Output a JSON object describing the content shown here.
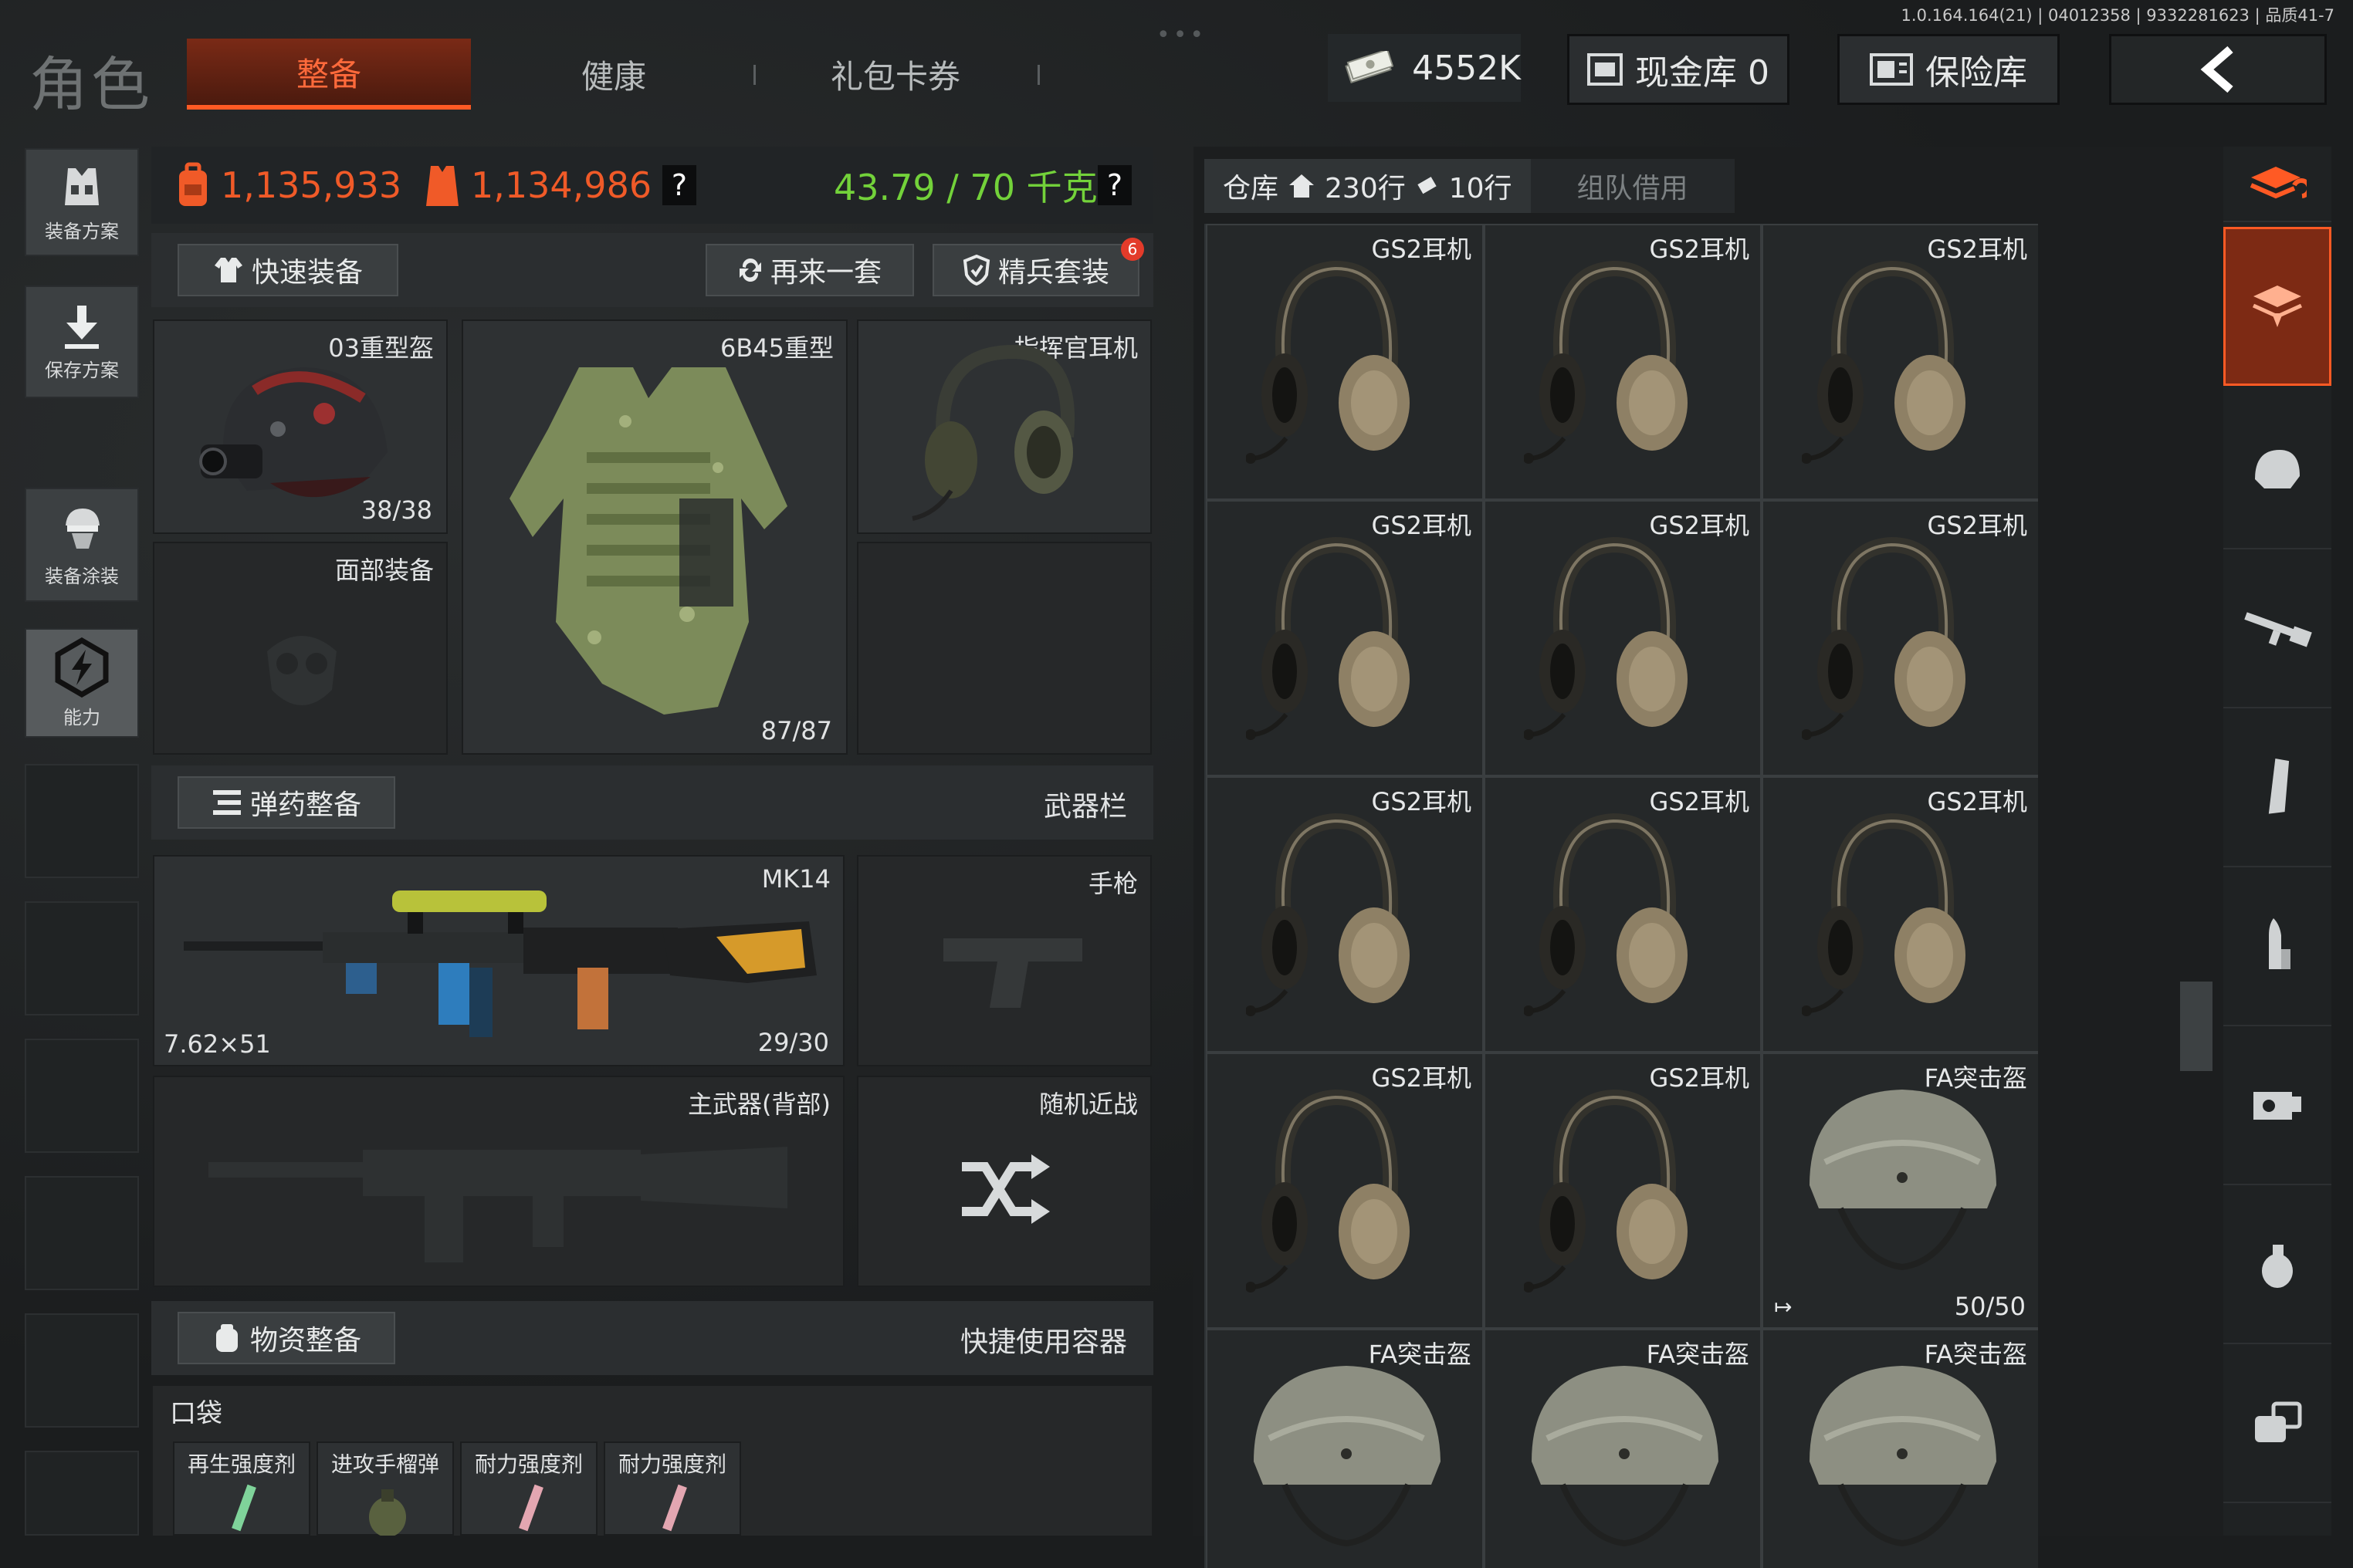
{
  "build_info": "1.0.164.164(21) | 04012358 | 9332281623 | 品质41-7",
  "header": {
    "title": "角色",
    "tabs": [
      {
        "label": "整备",
        "active": true
      },
      {
        "label": "健康",
        "active": false
      },
      {
        "label": "礼包卡券",
        "active": false
      }
    ],
    "currency_value": "4552K",
    "cash_vault_label": "现金库 0",
    "safe_label": "保险库",
    "back_icon": "chevron-left-icon"
  },
  "left_rail": [
    {
      "label": "装备方案",
      "icon": "vest-icon"
    },
    {
      "label": "保存方案",
      "icon": "download-icon"
    },
    {
      "label": "装备涂装",
      "icon": "soldier-icon"
    },
    {
      "label": "能力",
      "icon": "energy-icon"
    }
  ],
  "stats": {
    "value_a": "1,135,933",
    "value_b": "1,134,986",
    "weight": "43.79 / 70 千克",
    "help": "?",
    "accent_red": "#f05a28",
    "accent_green": "#73d23a"
  },
  "loadout": {
    "quick_equip": "快速装备",
    "again": "再来一套",
    "elite_set": "精兵套装",
    "elite_badge": "6",
    "helmet": {
      "label": "03重型盔",
      "count": "38/38"
    },
    "armor": {
      "label": "6B45重型",
      "count": "87/87"
    },
    "headset": {
      "label": "指挥官耳机"
    },
    "face": {
      "label": "面部装备"
    },
    "ammo_equip": "弹药整备",
    "weapon_bar": "武器栏",
    "primary": {
      "label": "MK14",
      "caliber": "7.62×51",
      "count": "29/30"
    },
    "pistol": {
      "label": "手枪"
    },
    "back_weapon": {
      "label": "主武器(背部)"
    },
    "melee": {
      "label": "随机近战"
    },
    "supplies": "物资整备",
    "quick_container": "快捷使用容器",
    "pocket": "口袋",
    "pocket_items": [
      "再生强度剂",
      "进攻手榴弹",
      "耐力强度剂",
      "耐力强度剂"
    ]
  },
  "warehouse": {
    "tab_label": "仓库",
    "rows_a": "230行",
    "rows_b": "10行",
    "team_borrow": "组队借用",
    "items": [
      {
        "label": "GS2耳机",
        "type": "headset"
      },
      {
        "label": "GS2耳机",
        "type": "headset"
      },
      {
        "label": "GS2耳机",
        "type": "headset"
      },
      {
        "label": "GS2耳机",
        "type": "headset"
      },
      {
        "label": "GS2耳机",
        "type": "headset"
      },
      {
        "label": "GS2耳机",
        "type": "headset"
      },
      {
        "label": "GS2耳机",
        "type": "headset"
      },
      {
        "label": "GS2耳机",
        "type": "headset"
      },
      {
        "label": "GS2耳机",
        "type": "headset"
      },
      {
        "label": "GS2耳机",
        "type": "headset"
      },
      {
        "label": "GS2耳机",
        "type": "headset"
      },
      {
        "label": "FA突击盔",
        "type": "helmet",
        "count": "50/50"
      },
      {
        "label": "FA突击盔",
        "type": "helmet"
      },
      {
        "label": "FA突击盔",
        "type": "helmet"
      },
      {
        "label": "FA突击盔",
        "type": "helmet"
      }
    ]
  },
  "category_rail": [
    "sort-icon",
    "storage-icon",
    "helmet-icon",
    "rifle-icon",
    "magazine-icon",
    "ammo-icon",
    "scope-icon",
    "grenade-icon",
    "misc-icon"
  ]
}
